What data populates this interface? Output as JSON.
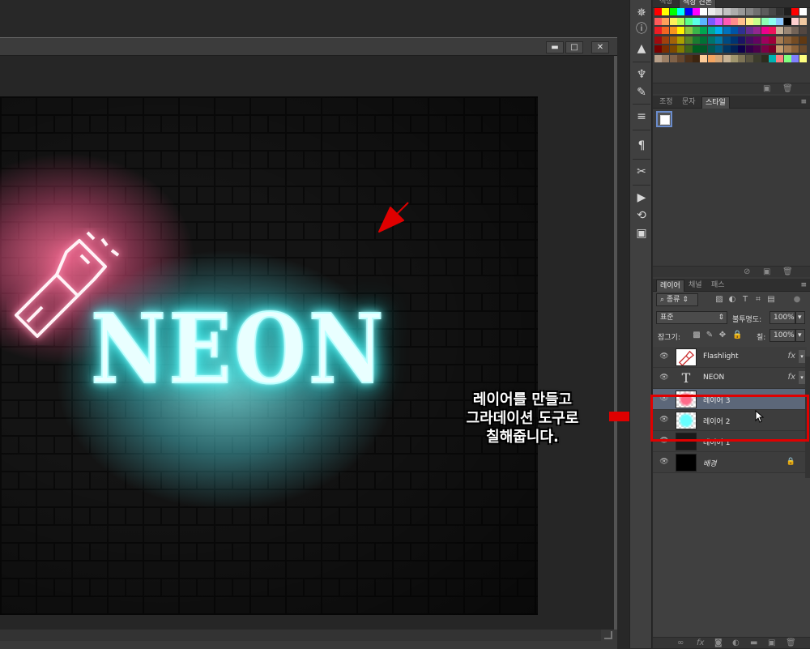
{
  "document": {
    "window_buttons": {
      "minimize": "▬",
      "restore": "□",
      "close": "✕"
    },
    "canvas": {
      "text": "NEON"
    }
  },
  "annotation": {
    "lines": [
      "레이어를 만들고",
      "그라데이션 도구로",
      "칠해줍니다."
    ],
    "arrow_color": "#e00000"
  },
  "panels": {
    "swatches": {
      "tabs": [
        "색상",
        "색상 견본"
      ],
      "active_tab": 1,
      "colors": [
        [
          "#ff0000",
          "#ffff00",
          "#00ff00",
          "#00ffff",
          "#0000ff",
          "#ff00ff",
          "#ffffff",
          "#ebebeb",
          "#d6d6d6",
          "#c2c2c2",
          "#adadad",
          "#999999",
          "#858585",
          "#707070",
          "#5c5c5c",
          "#474747",
          "#333333",
          "#1f1f1f",
          "#ff0000",
          "#ffffff"
        ],
        [
          "#ff5a5a",
          "#ffa05a",
          "#fff05a",
          "#b4ff5a",
          "#5aff8c",
          "#5affe6",
          "#5ab4ff",
          "#7a5aff",
          "#d25aff",
          "#ff5ab4",
          "#ff8c8c",
          "#ffc08c",
          "#fff08c",
          "#c8ff8c",
          "#8cffb4",
          "#8cfff0",
          "#8cc8ff",
          "#000000",
          "#ffd0d0",
          "#f0c8a0"
        ],
        [
          "#ed1c24",
          "#f26522",
          "#f7941d",
          "#fff200",
          "#8dc63f",
          "#39b54a",
          "#00a651",
          "#00a99d",
          "#00aeef",
          "#0072bc",
          "#0054a6",
          "#2e3192",
          "#662d91",
          "#92278f",
          "#ec008c",
          "#ed145b",
          "#c7b299",
          "#998675",
          "#736357",
          "#534741"
        ],
        [
          "#9e0b0f",
          "#a0410d",
          "#a36209",
          "#aba000",
          "#598527",
          "#1a7b30",
          "#007236",
          "#00746b",
          "#0076a3",
          "#004a80",
          "#003471",
          "#1b1464",
          "#440e62",
          "#630460",
          "#9e005d",
          "#9e0039",
          "#a67c52",
          "#8c6239",
          "#754c24",
          "#603913"
        ],
        [
          "#790000",
          "#7b2e00",
          "#7d4900",
          "#827b00",
          "#406618",
          "#005e20",
          "#005826",
          "#005952",
          "#005b7f",
          "#003663",
          "#002157",
          "#0d004c",
          "#32004b",
          "#4b0049",
          "#7b0046",
          "#7a0026",
          "#c69c6d",
          "#a67c52",
          "#8c6239",
          "#6b4a2b"
        ],
        [
          "#b8a08a",
          "#9c8066",
          "#806248",
          "#66472e",
          "#4d3019",
          "#3d2510",
          "#ffcc99",
          "#f4a460",
          "#d2a679",
          "#c8b496",
          "#a0966e",
          "#7d7355",
          "#5a5541",
          "#3c3c2d",
          "#2d2d1e",
          "#00b2b2",
          "#ff8080",
          "#80ff80",
          "#8080ff",
          "#ffff80"
        ]
      ]
    },
    "styles": {
      "tabs": [
        "조정",
        "문자",
        "스타일"
      ],
      "active_tab": 2
    },
    "layers": {
      "tabs": [
        "레이어",
        "채널",
        "패스"
      ],
      "active_tab": 0,
      "filter_kind": "종류",
      "blend_mode": "표준",
      "opacity_label": "불투명도:",
      "opacity_value": "100%",
      "lock_label": "잠그기:",
      "fill_label": "칠:",
      "fill_value": "100%",
      "items": [
        {
          "name": "Flashlight",
          "fx": "fx",
          "kind": "flashlight",
          "selected": false
        },
        {
          "name": "NEON",
          "fx": "fx",
          "kind": "text",
          "selected": false
        },
        {
          "name": "레이어 3",
          "fx": "",
          "kind": "pink",
          "selected": true
        },
        {
          "name": "레이어 2",
          "fx": "",
          "kind": "cyan",
          "selected": false
        },
        {
          "name": "레이어 1",
          "fx": "",
          "kind": "dark",
          "selected": false
        },
        {
          "name": "배경",
          "fx": "",
          "kind": "black",
          "selected": false,
          "locked": true
        }
      ]
    }
  }
}
